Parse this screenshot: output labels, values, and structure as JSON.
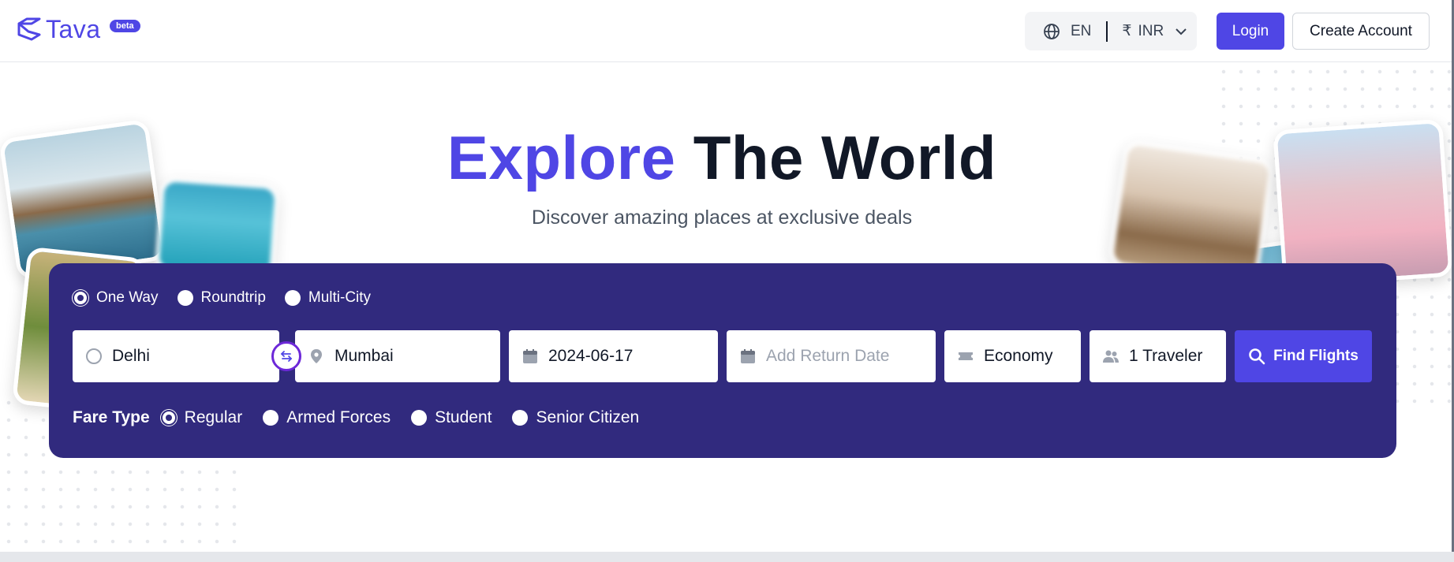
{
  "header": {
    "brand": "Tava",
    "beta_badge": "beta",
    "language": "EN",
    "currency_symbol": "₹",
    "currency": "INR",
    "login_label": "Login",
    "create_account_label": "Create Account"
  },
  "hero": {
    "title_accent": "Explore",
    "title_rest": "The World",
    "subtitle": "Discover amazing places at exclusive deals"
  },
  "search": {
    "trip_types": [
      {
        "label": "One Way",
        "selected": true
      },
      {
        "label": "Roundtrip",
        "selected": false
      },
      {
        "label": "Multi-City",
        "selected": false
      }
    ],
    "from": "Delhi",
    "to": "Mumbai",
    "departure_date": "2024-06-17",
    "return_placeholder": "Add Return Date",
    "cabin_class": "Economy",
    "travelers": "1 Traveler",
    "find_button": "Find Flights",
    "fare_type_label": "Fare Type",
    "fare_types": [
      {
        "label": "Regular",
        "selected": true
      },
      {
        "label": "Armed Forces",
        "selected": false
      },
      {
        "label": "Student",
        "selected": false
      },
      {
        "label": "Senior Citizen",
        "selected": false
      }
    ]
  },
  "colors": {
    "brand": "#4f46e5",
    "panel": "#312a7e",
    "heading_dark": "#111827"
  },
  "icons": [
    "tava-logo-icon",
    "globe-icon",
    "chevron-down-icon",
    "circle-icon",
    "swap-icon",
    "location-pin-icon",
    "calendar-icon",
    "ticket-icon",
    "users-icon",
    "search-icon"
  ]
}
